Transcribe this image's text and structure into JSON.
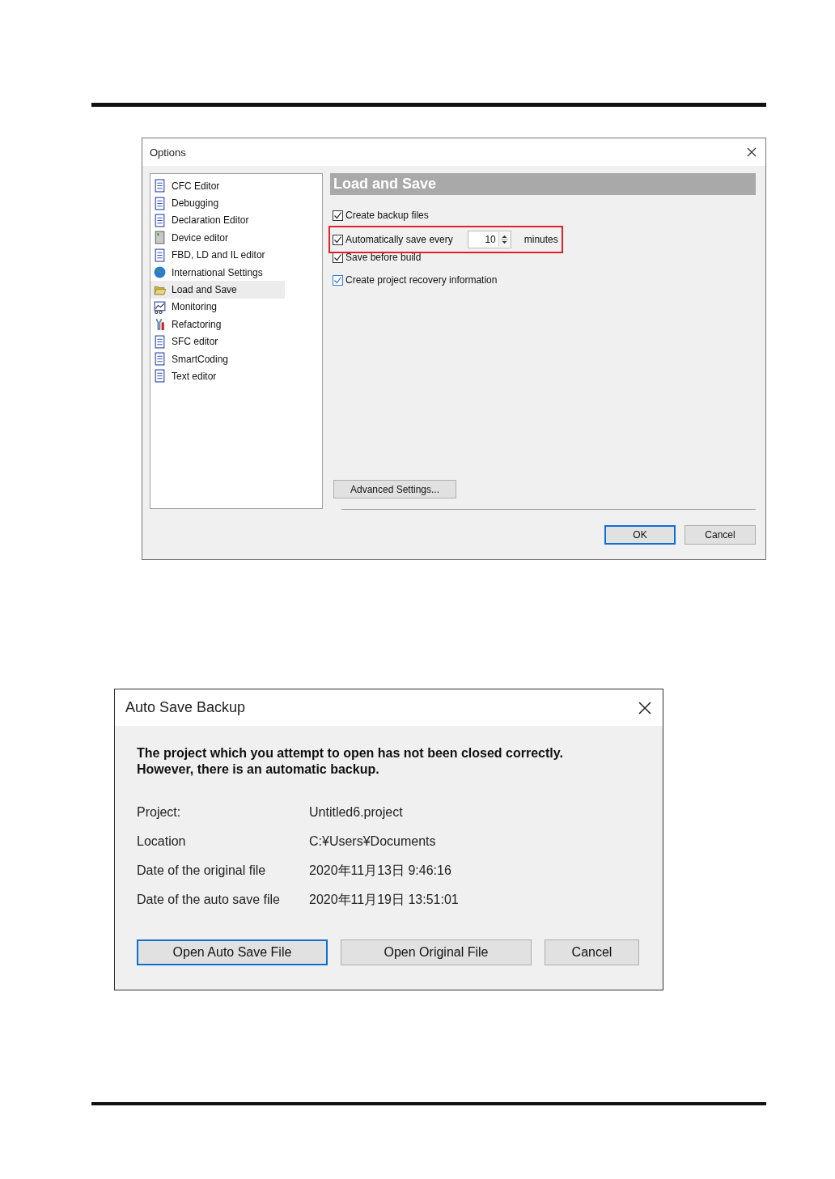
{
  "options_dialog": {
    "title": "Options",
    "categories": [
      {
        "label": "CFC Editor",
        "selected": false
      },
      {
        "label": "Debugging",
        "selected": false
      },
      {
        "label": "Declaration Editor",
        "selected": false
      },
      {
        "label": "Device editor",
        "selected": false
      },
      {
        "label": "FBD, LD and IL editor",
        "selected": false
      },
      {
        "label": "International Settings",
        "selected": false
      },
      {
        "label": "Load and Save",
        "selected": true
      },
      {
        "label": "Monitoring",
        "selected": false
      },
      {
        "label": "Refactoring",
        "selected": false
      },
      {
        "label": "SFC editor",
        "selected": false
      },
      {
        "label": "SmartCoding",
        "selected": false
      },
      {
        "label": "Text editor",
        "selected": false
      }
    ],
    "section_title": "Load and Save",
    "settings": [
      {
        "kind": "checkbox",
        "label": "Create backup files",
        "checked": true,
        "focused": false,
        "highlighted": false
      },
      {
        "kind": "interval",
        "label": "Automatically save every",
        "checked": true,
        "focused": false,
        "value": "10",
        "unit": "minutes",
        "highlighted": true
      },
      {
        "kind": "checkbox",
        "label": "Save before build",
        "checked": true,
        "focused": false,
        "highlighted": false
      },
      {
        "kind": "checkbox",
        "label": "Create project recovery information",
        "checked": true,
        "focused": true,
        "highlighted": false
      }
    ],
    "advanced_button": "Advanced Settings...",
    "buttons": [
      {
        "label": "OK",
        "default": true
      },
      {
        "label": "Cancel",
        "default": false
      }
    ]
  },
  "backup_dialog": {
    "title": "Auto Save Backup",
    "message": [
      "The project which you attempt to open has not been closed correctly.",
      "However, there is an automatic backup."
    ],
    "details": [
      {
        "label": "Project:",
        "value": "Untitled6.project"
      },
      {
        "label": "Location",
        "value": "C:¥Users¥Documents"
      },
      {
        "label": "Date of the original file",
        "value": "2020年11月13日 9:46:16"
      },
      {
        "label": "Date of the auto save file",
        "value": "2020年11月19日 13:51:01"
      }
    ],
    "buttons": [
      {
        "label": "Open Auto Save File",
        "default": true
      },
      {
        "label": "Open Original File",
        "default": false
      },
      {
        "label": "Cancel",
        "default": false
      }
    ]
  }
}
